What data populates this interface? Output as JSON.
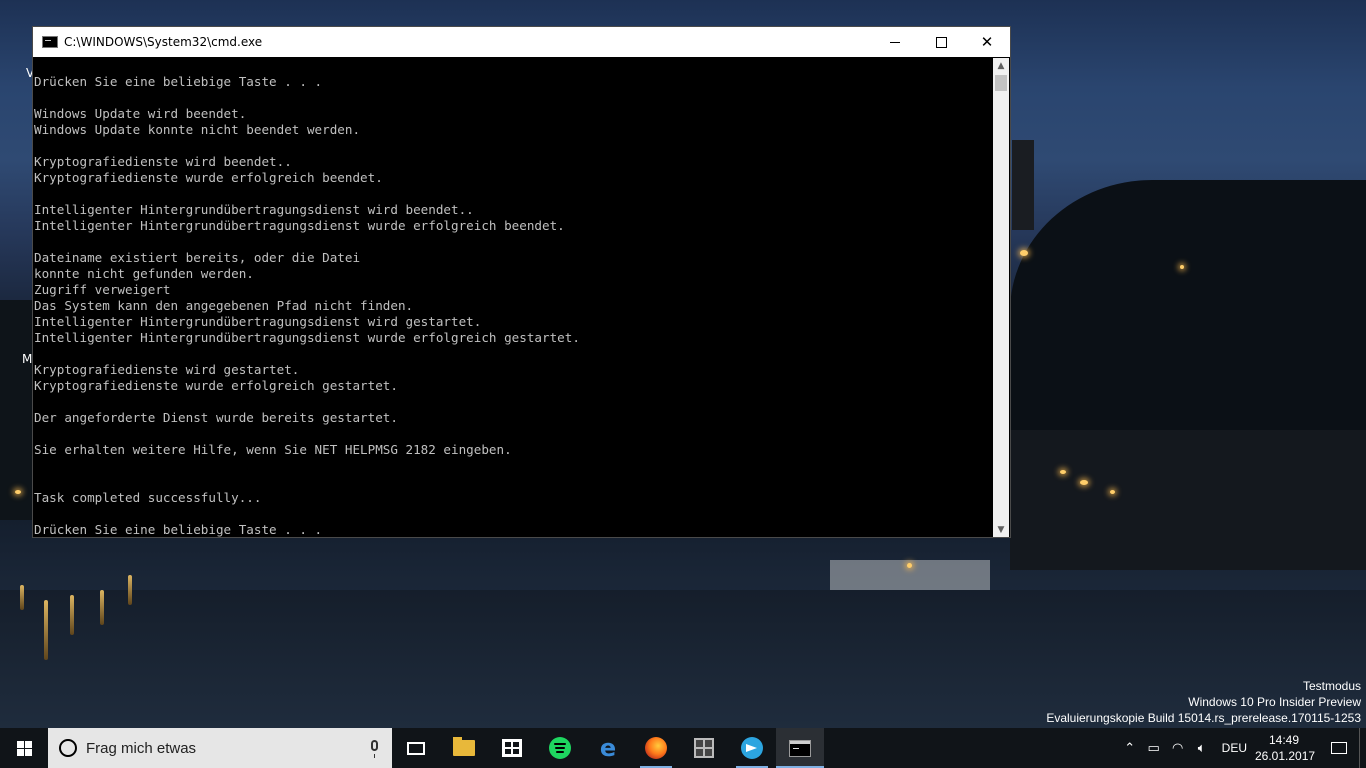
{
  "window": {
    "title": "C:\\WINDOWS\\System32\\cmd.exe",
    "minimize_glyph": "—",
    "maximize_glyph": "☐",
    "close_glyph": "✕"
  },
  "console": {
    "lines": [
      "Drücken Sie eine beliebige Taste . . .",
      "",
      "Windows Update wird beendet.",
      "Windows Update konnte nicht beendet werden.",
      "",
      "Kryptografiedienste wird beendet..",
      "Kryptografiedienste wurde erfolgreich beendet.",
      "",
      "Intelligenter Hintergrundübertragungsdienst wird beendet..",
      "Intelligenter Hintergrundübertragungsdienst wurde erfolgreich beendet.",
      "",
      "Dateiname existiert bereits, oder die Datei",
      "konnte nicht gefunden werden.",
      "Zugriff verweigert",
      "Das System kann den angegebenen Pfad nicht finden.",
      "Intelligenter Hintergrundübertragungsdienst wird gestartet.",
      "Intelligenter Hintergrundübertragungsdienst wurde erfolgreich gestartet.",
      "",
      "Kryptografiedienste wird gestartet.",
      "Kryptografiedienste wurde erfolgreich gestartet.",
      "",
      "Der angeforderte Dienst wurde bereits gestartet.",
      "",
      "Sie erhalten weitere Hilfe, wenn Sie NET HELPMSG 2182 eingeben.",
      "",
      "",
      "Task completed successfully...",
      "",
      "Drücken Sie eine beliebige Taste . . ."
    ]
  },
  "watermark": {
    "line1": "Testmodus",
    "line2": "Windows 10 Pro Insider Preview",
    "line3": "Evaluierungskopie Build 15014.rs_prerelease.170115-1253"
  },
  "desktop_peeks": {
    "a": "V",
    "b": "M"
  },
  "taskbar": {
    "search_placeholder": "Frag mich etwas",
    "apps": [
      {
        "name": "task-view",
        "icon": "task-view-icon"
      },
      {
        "name": "file-explorer",
        "icon": "folder-icon"
      },
      {
        "name": "store",
        "icon": "store-icon"
      },
      {
        "name": "spotify",
        "icon": "spotify-icon"
      },
      {
        "name": "edge",
        "icon": "edge-icon"
      },
      {
        "name": "firefox",
        "icon": "firefox-icon"
      },
      {
        "name": "qr-app",
        "icon": "qr-icon"
      },
      {
        "name": "telegram",
        "icon": "telegram-icon"
      },
      {
        "name": "cmd",
        "icon": "cmd-icon",
        "active": true
      }
    ],
    "tray": {
      "language": "DEU",
      "time": "14:49",
      "date": "26.01.2017"
    }
  }
}
